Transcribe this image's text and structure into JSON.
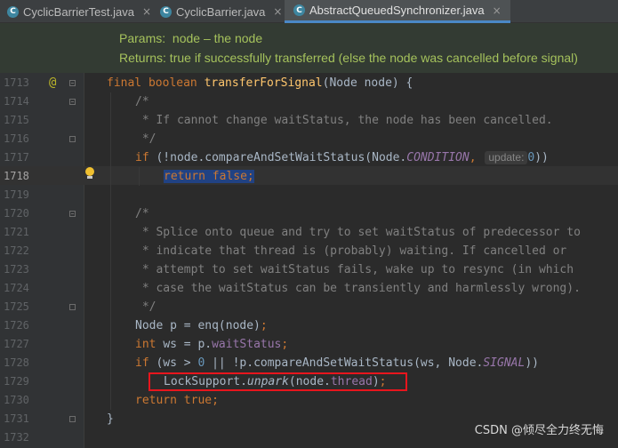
{
  "tabs": [
    {
      "label": "CyclicBarrierTest.java",
      "icon": "C",
      "active": false
    },
    {
      "label": "CyclicBarrier.java",
      "icon": "C",
      "active": false
    },
    {
      "label": "AbstractQueuedSynchronizer.java",
      "icon": "C",
      "active": true
    }
  ],
  "close_glyph": "×",
  "doc": {
    "params": "Params:  node – the node",
    "returns": "Returns: true if successfully transferred (else the node was cancelled before signal)"
  },
  "gutter": {
    "annotation": "@"
  },
  "lines": [
    "1713",
    "1714",
    "1715",
    "1716",
    "1717",
    "1718",
    "1719",
    "1720",
    "1721",
    "1722",
    "1723",
    "1724",
    "1725",
    "1726",
    "1727",
    "1728",
    "1729",
    "1730",
    "1731",
    "1732"
  ],
  "code": {
    "l1713": {
      "a": "final boolean ",
      "b": "transferForSignal",
      "c": "(Node node) {"
    },
    "l1714": "/*",
    "l1715": " * If cannot change waitStatus, the node has been cancelled.",
    "l1716": " */",
    "l1717": {
      "a": "if ",
      "b": "(!node.compareAndSetWaitStatus(Node.",
      "c": "CONDITION",
      "d": ", ",
      "hint": "update:",
      "e": "0",
      "f": "))"
    },
    "l1718": {
      "a": "return false",
      "b": ";"
    },
    "l1720": "/*",
    "l1721": " * Splice onto queue and try to set waitStatus of predecessor to",
    "l1722": " * indicate that thread is (probably) waiting. If cancelled or",
    "l1723": " * attempt to set waitStatus fails, wake up to resync (in which",
    "l1724": " * case the waitStatus can be transiently and harmlessly wrong).",
    "l1725": " */",
    "l1726": {
      "a": "Node p = enq(node)",
      "b": ";"
    },
    "l1727": {
      "a": "int ",
      "b": "ws = p.",
      "c": "waitStatus",
      "d": ";"
    },
    "l1728": {
      "a": "if ",
      "b": "(ws > ",
      "c": "0",
      "d": " || !p.compareAndSetWaitStatus(ws, Node.",
      "e": "SIGNAL",
      "f": "))"
    },
    "l1729": {
      "a": "LockSupport.",
      "b": "unpark",
      "c": "(node.",
      "d": "thread",
      "e": ")",
      "f": ";"
    },
    "l1730": {
      "a": "return true",
      "b": ";"
    },
    "l1731": "}"
  },
  "watermark": "CSDN @倾尽全力终无悔"
}
